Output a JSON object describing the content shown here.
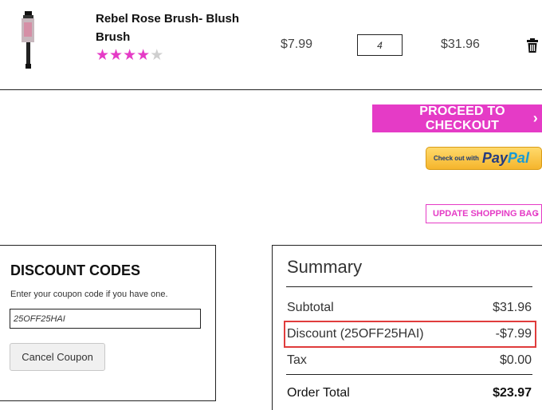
{
  "cart_item": {
    "name": "Rebel Rose Brush- Blush Brush",
    "rating": 4,
    "rating_max": 5,
    "price": "$7.99",
    "quantity": "4",
    "line_total": "$31.96",
    "remove_icon": "trash-icon"
  },
  "actions": {
    "checkout_label": "PROCEED TO CHECKOUT",
    "checkout_chevron": "›",
    "paypal_prefix": "Check out with",
    "paypal_pay": "Pay",
    "paypal_pal": "Pal",
    "update_label": "UPDATE SHOPPING BAG",
    "update_chevron": "›"
  },
  "discount": {
    "title": "DISCOUNT CODES",
    "help_text": "Enter your coupon code if you have one.",
    "code_value": "25OFF25HAI",
    "cancel_label": "Cancel Coupon"
  },
  "summary": {
    "title": "Summary",
    "subtotal_label": "Subtotal",
    "subtotal_value": "$31.96",
    "discount_label": "Discount (25OFF25HAI)",
    "discount_value": "-$7.99",
    "tax_label": "Tax",
    "tax_value": "$0.00",
    "order_total_label": "Order Total",
    "order_total_value": "$23.97"
  },
  "colors": {
    "accent": "#e53bc6",
    "highlight": "#e03c3c"
  }
}
